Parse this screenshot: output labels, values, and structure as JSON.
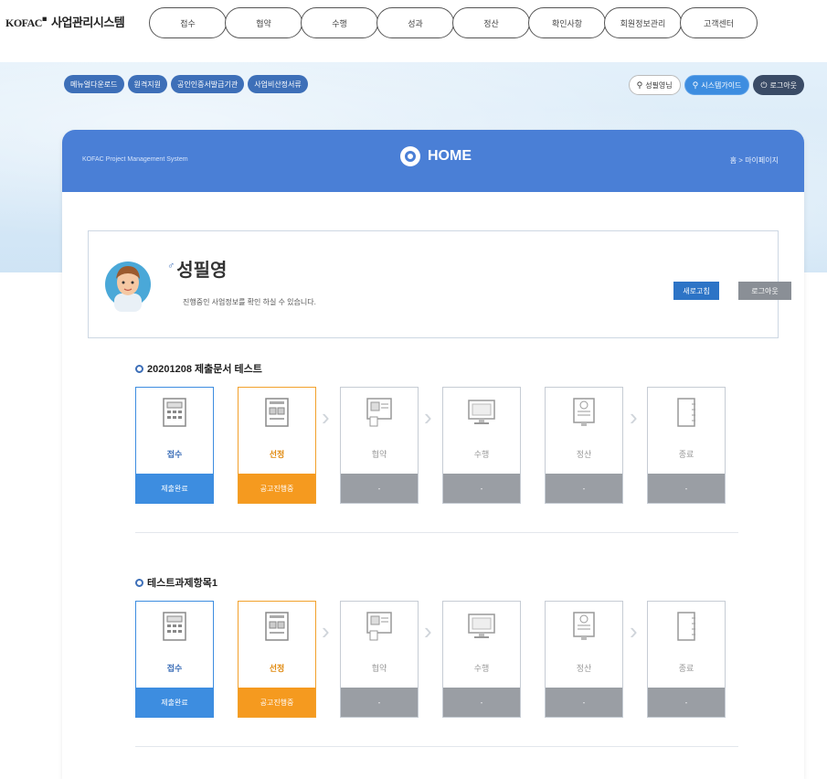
{
  "header": {
    "brand": "KOFAC",
    "brand_icon": "news-icon",
    "system_name": "사업관리시스템",
    "nav": [
      "접수",
      "협약",
      "수행",
      "성과",
      "정산",
      "확인사항",
      "회원정보관리",
      "고객센터"
    ]
  },
  "subnav": {
    "left": [
      "메뉴얼다운로드",
      "원격지원",
      "공인인증서발급기관",
      "사업비산정서류"
    ],
    "right": [
      {
        "label": "성필영님",
        "icon": "user-icon",
        "style": "white"
      },
      {
        "label": "시스템가이드",
        "icon": "user-icon",
        "style": "blue"
      },
      {
        "label": "로그아웃",
        "icon": "power-icon",
        "style": "dark"
      }
    ]
  },
  "panel": {
    "subtitle": "KOFAC Project Management System",
    "title": "HOME",
    "breadcrumb": "홈 > 마이페이지"
  },
  "profile": {
    "name": "성필영",
    "gender_symbol": "♂",
    "description": "진행중인 사업정보를 확인 하실 수 있습니다.",
    "modify_button": "새로고침",
    "logout_button": "로그아웃"
  },
  "projects": [
    {
      "title": "20201208 제출문서 테스트",
      "steps": [
        {
          "label": "접수",
          "status": "제출완료",
          "state": "done"
        },
        {
          "label": "선정",
          "status": "공고진행중",
          "state": "active"
        },
        {
          "label": "협약",
          "status": "-",
          "state": "pending"
        },
        {
          "label": "수행",
          "status": "-",
          "state": "pending"
        },
        {
          "label": "정산",
          "status": "-",
          "state": "pending"
        },
        {
          "label": "종료",
          "status": "-",
          "state": "pending"
        }
      ]
    },
    {
      "title": "테스트과제항목1",
      "steps": [
        {
          "label": "접수",
          "status": "제출완료",
          "state": "done"
        },
        {
          "label": "선정",
          "status": "공고진행중",
          "state": "active"
        },
        {
          "label": "협약",
          "status": "-",
          "state": "pending"
        },
        {
          "label": "수행",
          "status": "-",
          "state": "pending"
        },
        {
          "label": "정산",
          "status": "-",
          "state": "pending"
        },
        {
          "label": "종료",
          "status": "-",
          "state": "pending"
        }
      ]
    }
  ],
  "colors": {
    "accent": "#4a7fd6",
    "done": "#3d8de0",
    "active": "#f59a1f",
    "pending": "#9a9ea4"
  }
}
